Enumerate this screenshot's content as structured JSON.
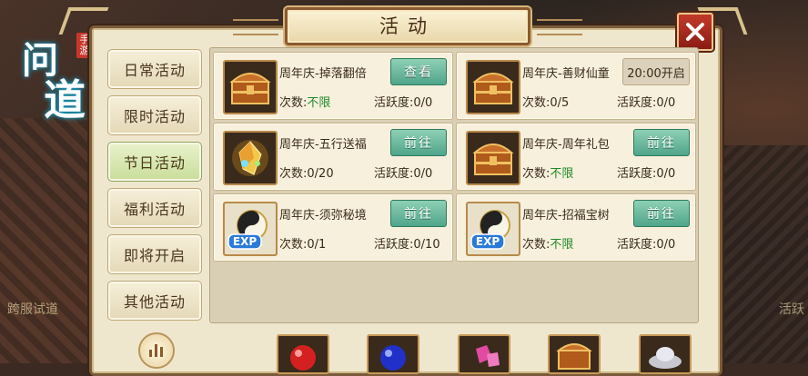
{
  "window": {
    "title": "活动"
  },
  "logo": {
    "text": "问道",
    "badge": "手游"
  },
  "background_labels": {
    "left": "跨服试道",
    "right": "活跃"
  },
  "sidebar": {
    "items": [
      {
        "label": "日常活动",
        "active": false
      },
      {
        "label": "限时活动",
        "active": false
      },
      {
        "label": "节日活动",
        "active": true
      },
      {
        "label": "福利活动",
        "active": false
      },
      {
        "label": "即将开启",
        "active": false
      },
      {
        "label": "其他活动",
        "active": false
      }
    ]
  },
  "activities": [
    {
      "name": "周年庆-掉落翻倍",
      "count_label": "次数:",
      "count": "不限",
      "active_label": "活跃度:",
      "active": "0/0",
      "button": "查看",
      "icon": "treasure-chest-icon"
    },
    {
      "name": "周年庆-善财仙童",
      "count_label": "次数:",
      "count": "0/5",
      "active_label": "活跃度:",
      "active": "0/0",
      "button": "20:00开启",
      "icon": "treasure-chest-icon"
    },
    {
      "name": "周年庆-五行送福",
      "count_label": "次数:",
      "count": "0/20",
      "active_label": "活跃度:",
      "active": "0/0",
      "button": "前往",
      "icon": "gem-icon"
    },
    {
      "name": "周年庆-周年礼包",
      "count_label": "次数:",
      "count": "不限",
      "active_label": "活跃度:",
      "active": "0/0",
      "button": "前往",
      "icon": "treasure-chest-icon"
    },
    {
      "name": "周年庆-须弥秘境",
      "count_label": "次数:",
      "count": "0/1",
      "active_label": "活跃度:",
      "active": "0/10",
      "button": "前往",
      "icon": "exp-icon"
    },
    {
      "name": "周年庆-招福宝树",
      "count_label": "次数:",
      "count": "不限",
      "active_label": "活跃度:",
      "active": "0/0",
      "button": "前往",
      "icon": "exp-icon"
    }
  ],
  "colors": {
    "accent_green": "#4fa58a",
    "close_red": "#c23a2a",
    "unlimited_green": "#1f8a2a"
  }
}
